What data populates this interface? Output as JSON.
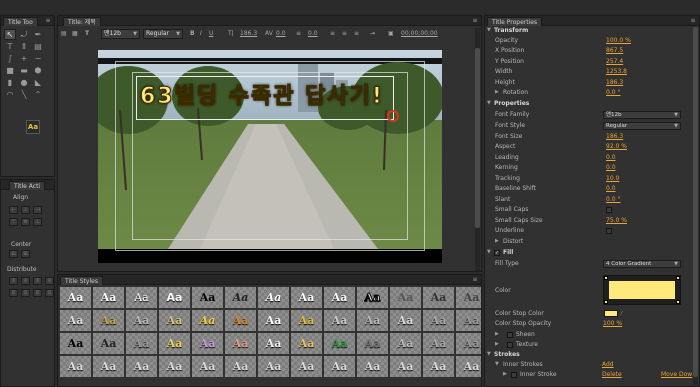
{
  "tools_panel": {
    "tab": "Title Too",
    "tools": [
      "selection-tool",
      "rotation-tool",
      "type-tool",
      "vertical-type-tool",
      "area-type-tool",
      "vertical-area-type-tool",
      "path-type-tool",
      "vertical-path-type-tool",
      "pen-tool",
      "delete-anchor-tool",
      "add-anchor-tool",
      "convert-anchor-tool",
      "rectangle-tool",
      "rounded-rectangle-tool",
      "clipped-corner-tool",
      "rounded-corner-tool",
      "wedge-tool",
      "arc-tool",
      "ellipse-tool",
      "line-tool"
    ],
    "sample_label": "Aa"
  },
  "actions_panel": {
    "tab": "Title Acti",
    "align_label": "Align",
    "center_label": "Center",
    "distribute_label": "Distribute"
  },
  "editor": {
    "tab": "Title: 제목",
    "font_family": "맨12b",
    "font_style": "Regular",
    "font_size": "186.3",
    "kerning": "0.0",
    "leading": "0.0",
    "timecode": "00;00;00;00",
    "caption_text": "63빌딩 수족관 답사기!"
  },
  "styles_panel": {
    "tab": "Title Styles",
    "sample": "Aa"
  },
  "properties_panel": {
    "tab": "Title Properties",
    "sections": {
      "transform": "Transform",
      "properties": "Properties",
      "fill": "Fill",
      "strokes": "Strokes"
    },
    "transform": [
      {
        "label": "Opacity",
        "value": "100.0 %"
      },
      {
        "label": "X Position",
        "value": "867.5"
      },
      {
        "label": "Y Position",
        "value": "257.4"
      },
      {
        "label": "Width",
        "value": "1253.8"
      },
      {
        "label": "Height",
        "value": "186.3"
      },
      {
        "label": "Rotation",
        "value": "0.0 °"
      }
    ],
    "font_family_label": "Font Family",
    "font_family": "맨12b",
    "font_style_label": "Font Style",
    "font_style": "Regular",
    "text_props": [
      {
        "label": "Font Size",
        "value": "186.3"
      },
      {
        "label": "Aspect",
        "value": "92.0 %"
      },
      {
        "label": "Leading",
        "value": "0.0"
      },
      {
        "label": "Kerning",
        "value": "0.0"
      },
      {
        "label": "Tracking",
        "value": "10.0"
      },
      {
        "label": "Baseline Shift",
        "value": "0.0"
      },
      {
        "label": "Slant",
        "value": "0.0 °"
      }
    ],
    "small_caps_label": "Small Caps",
    "small_caps_size_label": "Small Caps Size",
    "small_caps_size": "75.0 %",
    "underline_label": "Underline",
    "distort_label": "Distort",
    "fill_type_label": "Fill Type",
    "fill_type": "4 Color Gradient",
    "color_label": "Color",
    "color_stop_color_label": "Color Stop Color",
    "color_stop_opacity_label": "Color Stop Opacity",
    "color_stop_opacity": "100 %",
    "sheen_label": "Sheen",
    "texture_label": "Texture",
    "inner_strokes_label": "Inner Strokes",
    "inner_stroke_label": "Inner Stroke",
    "add_label": "Add",
    "delete_label": "Delete",
    "move_down_label": "Move Dow"
  },
  "colors": {
    "accent": "#e8a53a",
    "gradient_fill": "#ffe97a",
    "panel": "#313131"
  }
}
